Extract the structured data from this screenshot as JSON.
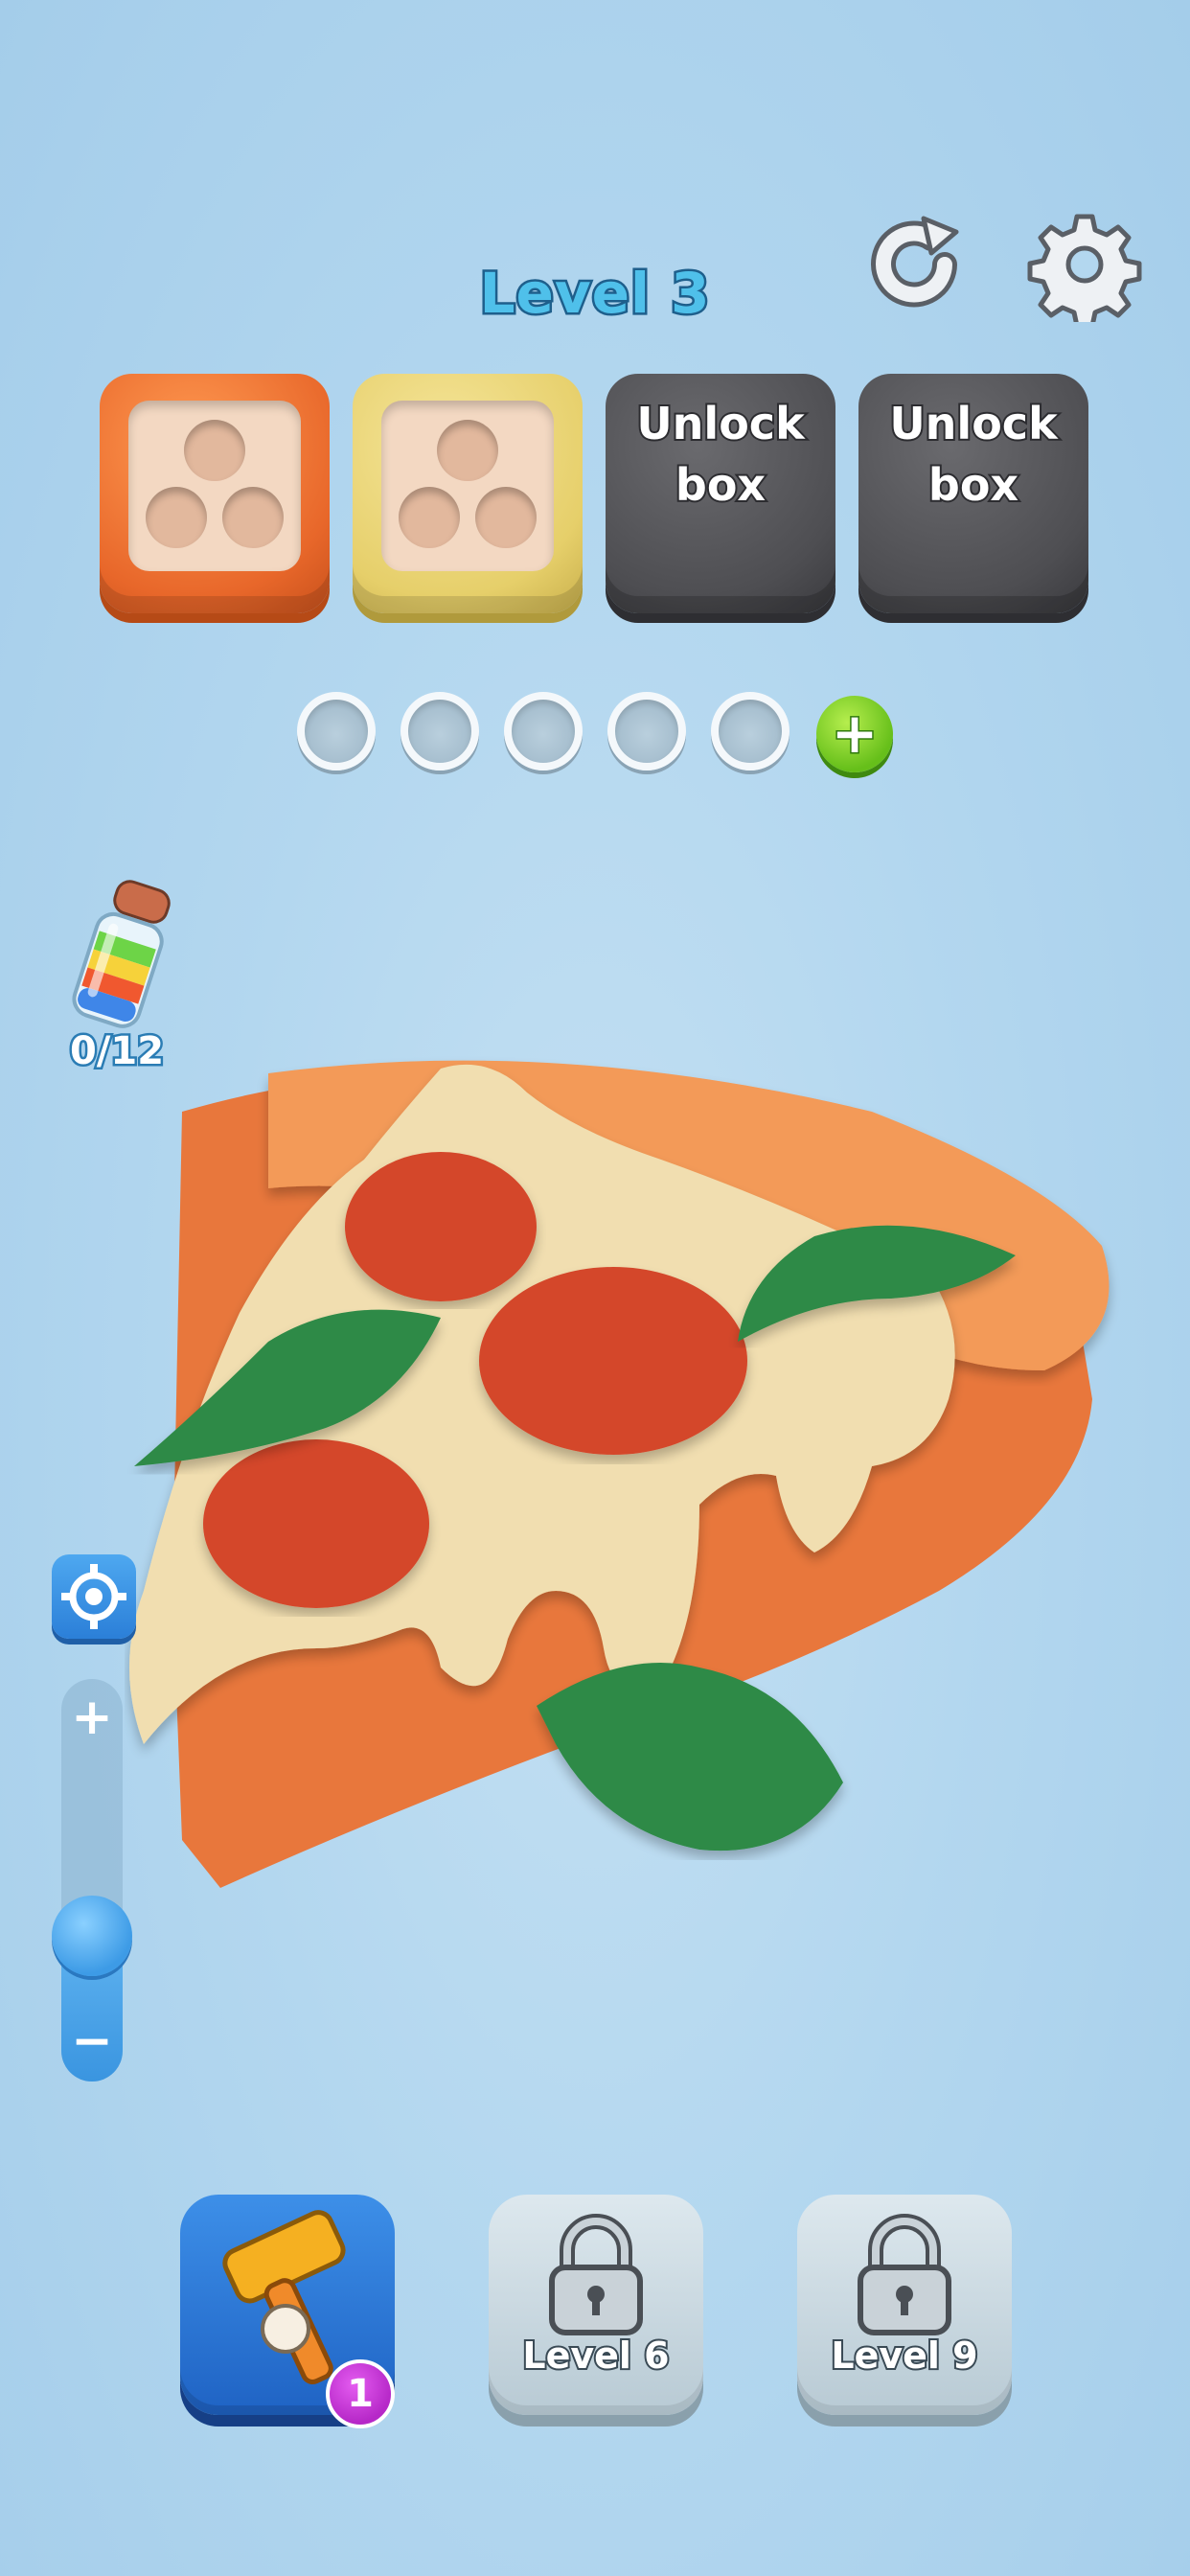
{
  "header": {
    "level_title": "Level 3",
    "restart_icon": "restart-icon",
    "settings_icon": "gear-icon"
  },
  "boxes": [
    {
      "type": "open",
      "color": "#e8672a"
    },
    {
      "type": "open",
      "color": "#e6cf6a"
    },
    {
      "type": "locked",
      "label_line1": "Unlock",
      "label_line2": "box"
    },
    {
      "type": "locked",
      "label_line1": "Unlock",
      "label_line2": "box"
    }
  ],
  "slots": {
    "empty_count": 5,
    "add_label": "+"
  },
  "jar": {
    "count": "0/12"
  },
  "zoom": {
    "plus_label": "+",
    "minus_label": "−",
    "level": 0.35
  },
  "tools": {
    "hammer_badge": "1",
    "locked_1_label": "Level 6",
    "locked_2_label": "Level 9"
  },
  "colors": {
    "background": "#b3d7ef",
    "crust": "#f0924e",
    "cheese": "#f1deb0",
    "pepperoni": "#d4462c",
    "basil": "#2e8a46"
  }
}
